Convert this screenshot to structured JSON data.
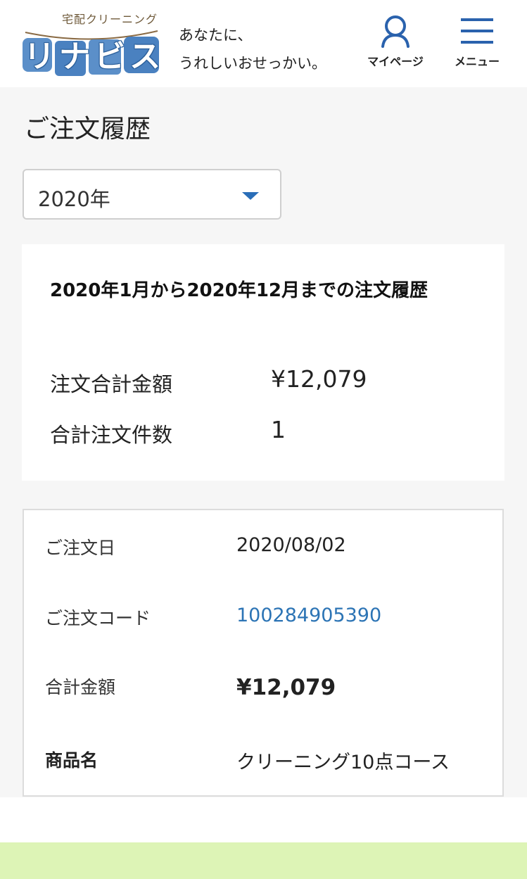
{
  "header": {
    "logo_small": "宅配クリーニング",
    "logo_main": "リナビス",
    "tagline": [
      "あなたに、",
      "うれしいおせっかい。"
    ],
    "mypage_label": "マイページ",
    "menu_label": "メニュー",
    "icon_mypage": "user-icon",
    "icon_menu": "hamburger-icon"
  },
  "page": {
    "title": "ご注文履歴"
  },
  "year_select": {
    "selected": "2020年",
    "icon": "caret-down-icon",
    "accent": "#2a6eb8"
  },
  "summary": {
    "heading": "2020年1月から2020年12月までの注文履歴",
    "rows": [
      {
        "label": "注文合計金額",
        "value": "¥12,079"
      },
      {
        "label": "合計注文件数",
        "value": "1"
      }
    ]
  },
  "orders": [
    {
      "date_label": "ご注文日",
      "date": "2020/08/02",
      "code_label": "ご注文コード",
      "code": "100284905390",
      "total_label": "合計金額",
      "total": "¥12,079",
      "product_label": "商品名",
      "product": "クリーニング10点コース"
    }
  ],
  "colors": {
    "link": "#2c74b5",
    "footer_band": "#ddf4b6",
    "page_bg": "#f6f6f6"
  }
}
